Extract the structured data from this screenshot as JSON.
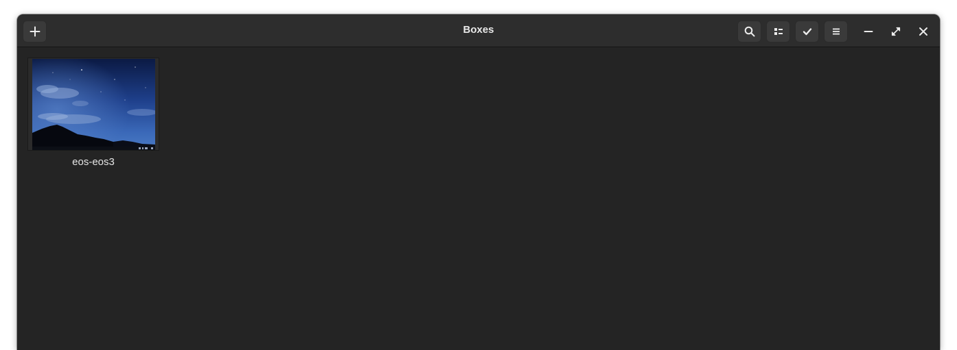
{
  "window": {
    "title": "Boxes"
  },
  "headerbar": {
    "new_button_icon": "plus-icon",
    "search_button_icon": "search-icon",
    "view_button_icon": "list-view-icon",
    "select_button_icon": "checkmark-icon",
    "menu_button_icon": "hamburger-menu-icon",
    "minimize_icon": "minimize-icon",
    "maximize_icon": "maximize-icon",
    "close_icon": "close-icon"
  },
  "boxes": [
    {
      "name": "eos-eos3",
      "thumbnail": "night-sky-mountain-thumbnail"
    }
  ],
  "colors": {
    "window_bg": "#242424",
    "headerbar_bg": "#2d2d2d",
    "button_bg": "#3a3a3a",
    "text": "#e8e8e8"
  }
}
